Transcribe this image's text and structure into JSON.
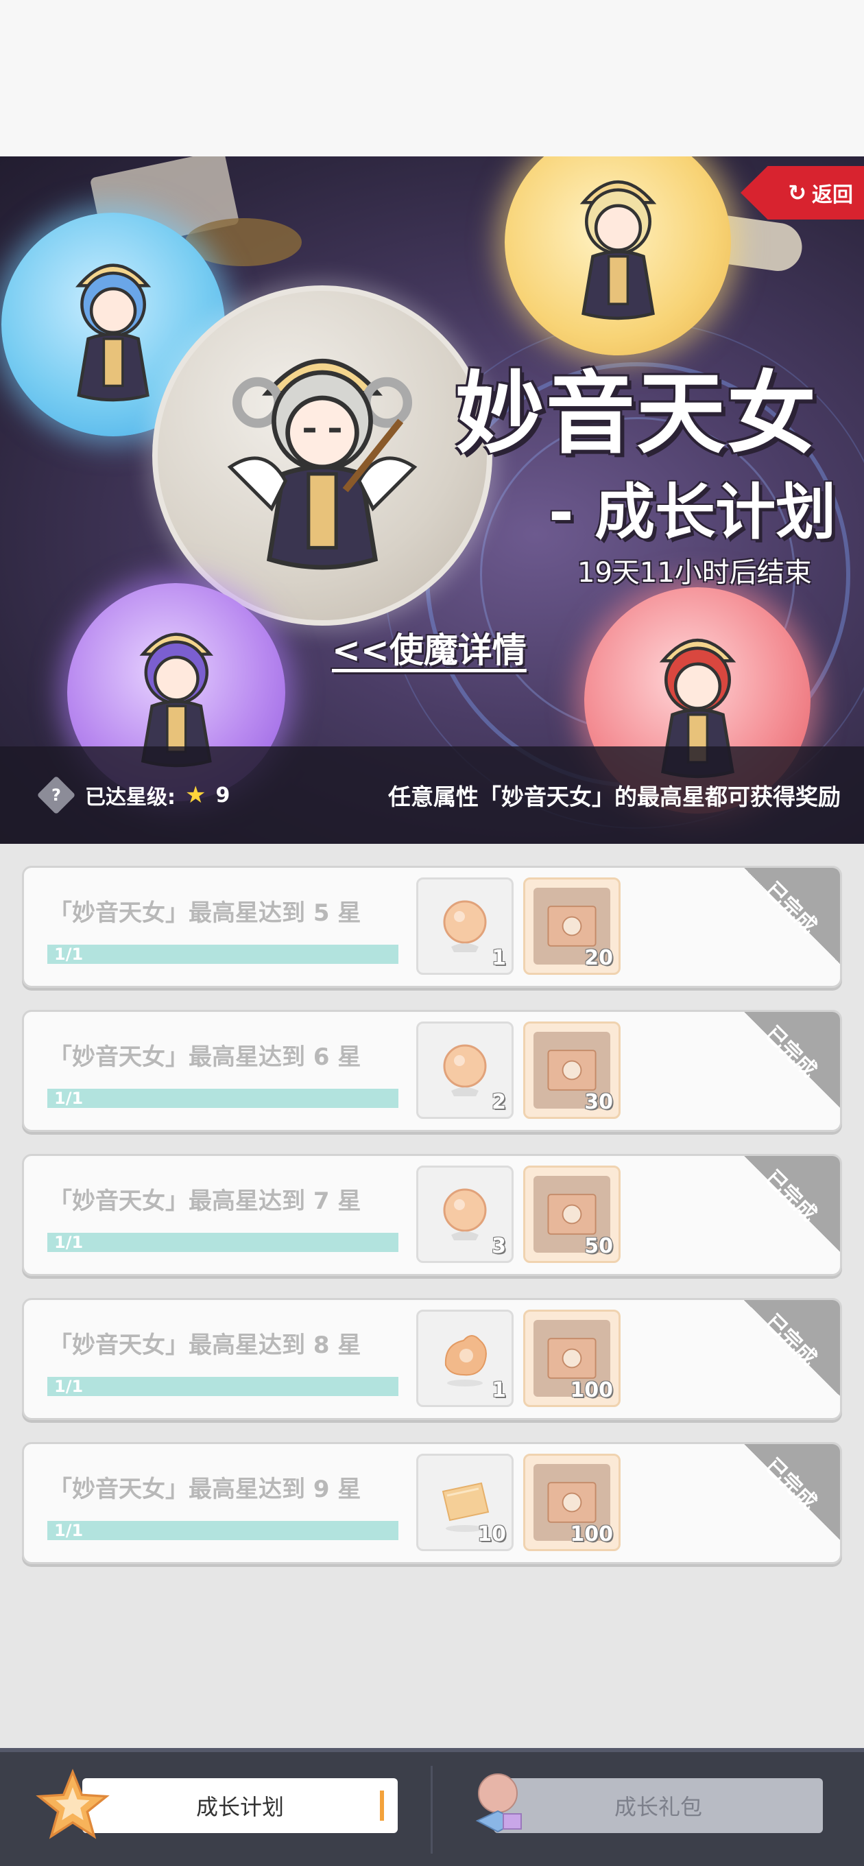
{
  "header": {
    "back_label": "返回",
    "title": "妙音天女",
    "subtitle": "- 成长计划",
    "countdown": "19天11小时后结束",
    "details_link": "<<使魔详情"
  },
  "info_bar": {
    "star_level_label": "已达星级:",
    "star_level_value": "9",
    "reward_note": "任意属性「妙音天女」的最高星都可获得奖励"
  },
  "tasks": [
    {
      "title": "「妙音天女」最高星达到 5 星",
      "progress_text": "1/1",
      "progress": 1.0,
      "reward1_count": "1",
      "reward2_count": "20",
      "status": "已完成"
    },
    {
      "title": "「妙音天女」最高星达到 6 星",
      "progress_text": "1/1",
      "progress": 1.0,
      "reward1_count": "2",
      "reward2_count": "30",
      "status": "已完成"
    },
    {
      "title": "「妙音天女」最高星达到 7 星",
      "progress_text": "1/1",
      "progress": 1.0,
      "reward1_count": "3",
      "reward2_count": "50",
      "status": "已完成"
    },
    {
      "title": "「妙音天女」最高星达到 8 星",
      "progress_text": "1/1",
      "progress": 1.0,
      "reward1_count": "1",
      "reward2_count": "100",
      "status": "已完成"
    },
    {
      "title": "「妙音天女」最高星达到 9 星",
      "progress_text": "1/1",
      "progress": 1.0,
      "reward1_count": "10",
      "reward2_count": "100",
      "status": "已完成"
    }
  ],
  "tabs": {
    "growth_plan": "成长计划",
    "growth_gift": "成长礼包"
  },
  "colors": {
    "back_button": "#d8232f",
    "progress_fill": "#b2e3de",
    "tab_accent": "#f3a23b"
  }
}
